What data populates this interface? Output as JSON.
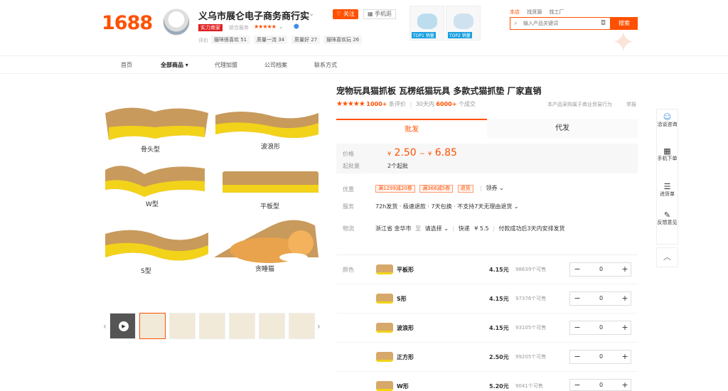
{
  "header": {
    "logo": "1688",
    "shop_name": "义乌市展仑电子商务商行实",
    "follow_label": "♡ 关注",
    "mobile_label": "▦ 手机逛",
    "badge": "实力商家",
    "service_label": "综合服务",
    "service_stars": "★★★★★",
    "eval_label": "评价",
    "eval_tags": [
      "猫咪很喜欢 51",
      "质量一流 34",
      "质量好 27",
      "猫咪喜欢玩 26"
    ],
    "top_products": [
      {
        "tag": "TOP1 销量"
      },
      {
        "tag": "TOP2 销量"
      }
    ]
  },
  "search": {
    "tabs": [
      "本店",
      "找货源",
      "找工厂"
    ],
    "placeholder": "输入产品关键词",
    "button": "搜索"
  },
  "nav": {
    "items": [
      "首页",
      "全部商品",
      "代理加盟",
      "公司档案",
      "联系方式"
    ]
  },
  "gallery": {
    "labels": [
      "骨头型",
      "波浪形",
      "W型",
      "平板型",
      "S型",
      "贪睡猫"
    ]
  },
  "product": {
    "title": "宠物玩具猫抓板 瓦楞纸猫玩具 多款式猫抓垫 厂家直销",
    "stars": "★★★★★",
    "review_count": "1000+",
    "review_suffix": "条评价",
    "sales_prefix": "30天内",
    "sales_count": "6000+",
    "sales_suffix": "个成交",
    "right_note": "本产品采购属于商业贸易行为",
    "report": "举报"
  },
  "tabs": [
    "批发",
    "代发"
  ],
  "price": {
    "label": "价格",
    "low": "2.50",
    "high": "6.85",
    "yen": "¥",
    "tilde": "~",
    "moq_label": "起批量",
    "moq_value": "2个起批"
  },
  "promo": {
    "label": "优惠",
    "coupons": [
      "满1299减20券",
      "满366减5券",
      "退货"
    ],
    "more": "领券"
  },
  "service": {
    "label": "服务",
    "value": "72h发货 · 极速退款 · 7天包换 · 不支持7天无理由退货"
  },
  "logistics": {
    "label": "物流",
    "origin": "浙江省 金华市",
    "to": "至",
    "dest": "请选择",
    "express": "快递",
    "fee": "¥ 5.5",
    "note": "付款成功后3天内安排发货"
  },
  "sku": {
    "label": "颜色",
    "rows": [
      {
        "name": "平板形",
        "price": "4.15元",
        "stock": "98639个可售",
        "qty": "0"
      },
      {
        "name": "S形",
        "price": "4.15元",
        "stock": "97376个可售",
        "qty": "0"
      },
      {
        "name": "波浪形",
        "price": "4.15元",
        "stock": "93105个可售",
        "qty": "0"
      },
      {
        "name": "正方形",
        "price": "2.50元",
        "stock": "99205个可售",
        "qty": "0"
      },
      {
        "name": "W形",
        "price": "5.20元",
        "stock": "9041个可售",
        "qty": "0"
      }
    ]
  },
  "sidebar": {
    "items": [
      "洽谈咨询",
      "手机下单",
      "进货单",
      "反馈意见"
    ]
  },
  "colors": {
    "accent": "#ff5000",
    "pad_yellow": "#f3d21a",
    "cardboard": "#c89a5c"
  }
}
